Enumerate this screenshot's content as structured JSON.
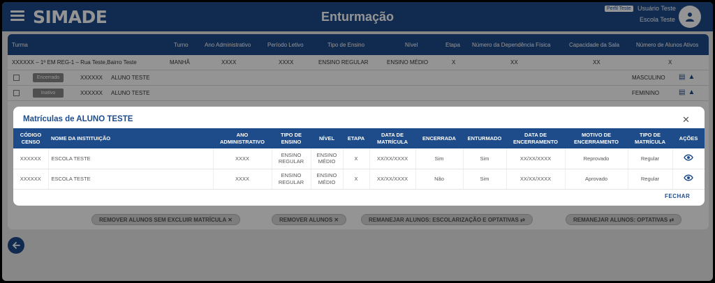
{
  "header": {
    "logo": "SIMADE",
    "title": "Enturmação",
    "profile_badge": "Perfil Teste",
    "user_name": "Usuário Teste",
    "school_name": "Escola Teste"
  },
  "background_table": {
    "columns": [
      "Turma",
      "Turno",
      "Ano Administrativo",
      "Período Letivo",
      "Tipo de Ensino",
      "Nível",
      "Etapa",
      "Número da Dependência Física",
      "Capacidade da Sala",
      "Número de Alunos Ativos"
    ],
    "row": [
      "XXXXXX – 1º EM REG-1 – Rua Teste,Bairro Teste",
      "MANHÃ",
      "XXXX",
      "XXXX",
      "ENSINO REGULAR",
      "ENSINO MÉDIO",
      "X",
      "XX",
      "XX",
      "X"
    ],
    "students": [
      {
        "status": "Encerrado",
        "code": "XXXXXX",
        "name": "ALUNO TESTE",
        "sex": "MASCULINO"
      },
      {
        "status": "Inativo",
        "code": "XXXXXX",
        "name": "ALUNO TESTE",
        "sex": "FEMININO"
      }
    ],
    "actions": [
      "REMOVER ALUNOS SEM EXCLUIR MATRÍCULA",
      "REMOVER ALUNOS",
      "REMANEJAR ALUNOS: ESCOLARIZAÇÃO E OPTATIVAS",
      "REMANEJAR ALUNOS: OPTATIVAS"
    ]
  },
  "modal": {
    "title": "Matrículas de ALUNO TESTE",
    "close_label": "FECHAR",
    "columns": [
      "Código Censo",
      "Nome da Instituição",
      "Ano Administrativo",
      "Tipo de Ensino",
      "Nível",
      "Etapa",
      "Data de Matrícula",
      "Encerrada",
      "Enturmado",
      "Data de Encerramento",
      "Motivo de Encerramento",
      "Tipo de Matrícula",
      "Ações"
    ],
    "rows": [
      [
        "XXXXXX",
        "ESCOLA TESTE",
        "XXXX",
        "ENSINO REGULAR",
        "ENSINO MÉDIO",
        "X",
        "XX/XX/XXXX",
        "Sim",
        "Sim",
        "XX/XX/XXXX",
        "Reprovado",
        "Regular"
      ],
      [
        "XXXXXX",
        "ESCOLA TESTE",
        "XXXX",
        "ENSINO REGULAR",
        "ENSINO MÉDIO",
        "X",
        "XX/XX/XXXX",
        "Não",
        "Sim",
        "XX/XX/XXXX",
        "Aprovado",
        "Regular"
      ]
    ]
  },
  "colors": {
    "primary": "#1e4b8a",
    "header_text": "#ffffff"
  },
  "icons": [
    "menu-icon",
    "user-icon",
    "close-icon",
    "eye-icon",
    "document-icon",
    "graduation-cap-icon",
    "arrow-left-icon"
  ]
}
